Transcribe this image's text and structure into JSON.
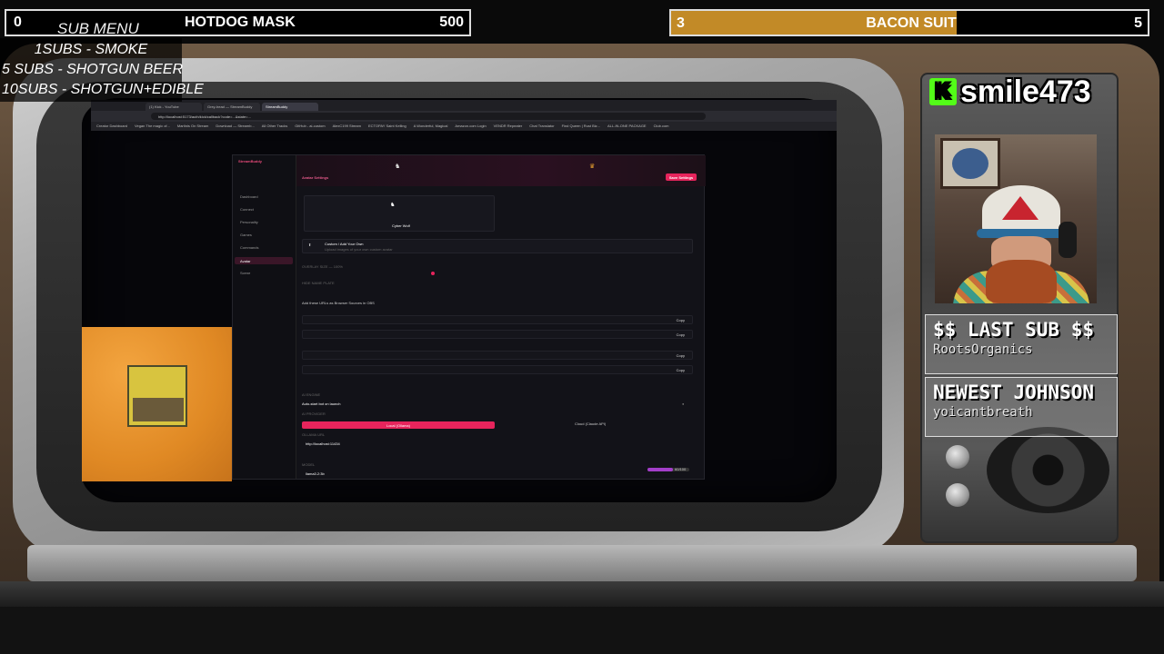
{
  "goal_left": {
    "current": "0",
    "label": "HOTDOG MASK",
    "target": "500",
    "sub_menu_title": "SUB MENU"
  },
  "goal_right": {
    "current": "3",
    "label": "BACON SUIT",
    "target": "5",
    "progress_fraction": 0.6
  },
  "sub_menu": [
    "1SUBS   - SMOKE",
    "5 SUBS  - SHOTGUN BEER",
    "10SUBS - SHOTGUN+EDIBLE"
  ],
  "streamer": {
    "platform_icon": "K",
    "username": "smile473"
  },
  "last_sub": {
    "title": "$$ LAST SUB $$",
    "name": "RootsOrganics"
  },
  "newest": {
    "title": "NEWEST JOHNSON",
    "name": "yoicantbreath"
  },
  "browser": {
    "tabs": [
      "(1) Kick - YouTube",
      "Grey-head — StreamBuddy",
      "StreamBuddy"
    ],
    "url": "http://localhost:5173/auth/kick/callback?code=...&state=...",
    "bookmarks": [
      "Creator Dashboard",
      "Vegan The magic of...",
      "Martinis On Stream",
      "Download — Streamb...",
      "All Other Tracks",
      "GitHub - ai-custom",
      "AlexC199 Stream",
      "ECTOPAY Saint Kelling",
      "A Wonderful, Magical",
      "Amazon.com Login",
      "VENDR Repeater",
      "Chat Translator",
      "Find Queen | Rust Biz...",
      "ALL-IN-ONE PACKAGE",
      "Club.com"
    ]
  },
  "app": {
    "brand": "StreamBuddy",
    "header_title": "Avatar Settings",
    "save_label": "Save Settings",
    "nav": [
      "Dashboard",
      "Connect",
      "Personality",
      "Games",
      "Commands",
      "Avatar",
      "Scene"
    ],
    "avatar_name": "Cyber Wolf",
    "custom_title": "Custom / Add Your Own",
    "custom_sub": "Upload images of your own custom avatar",
    "overlay_size": "OVERLAY SIZE — 100%",
    "hide_name": "HIDE NAME PLATE",
    "urls_note": "Add these URLs as Browser Sources in OBS",
    "copy_label": "Copy",
    "ai_section": "AI ENGINE",
    "autostart": "Auto-start bot on launch",
    "provider_label": "AI PROVIDER",
    "provider_local": "Local (Ollama)",
    "provider_cloud": "Cloud (Claude API)",
    "ollama_url_label": "OLLAMA URL",
    "ollama_url": "http://localhost:11434",
    "model_label": "MODEL",
    "model": "llama3.2:3b",
    "slider_value": "60/100"
  },
  "colors": {
    "accent": "#e6245c",
    "goal_fill": "#c28a27",
    "kick_green": "#53fc18"
  }
}
